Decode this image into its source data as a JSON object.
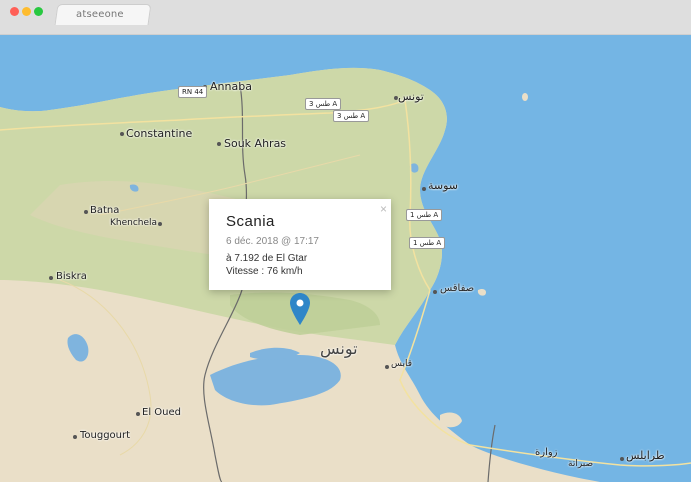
{
  "browser": {
    "tab_title": "atseeone"
  },
  "popup": {
    "title": "Scania",
    "date": "6 déc. 2018 @ 17:17",
    "location": "à 7.192 de El Gtar",
    "speed": "Vitesse : 76 km/h",
    "close": "×"
  },
  "map": {
    "cities": [
      "Annaba",
      "Constantine",
      "Souk Ahras",
      "Batna",
      "Khenchela",
      "Biskra",
      "El Oued",
      "Touggourt",
      "تونس",
      "سوسة",
      "صفاقس",
      "قابس",
      "زوارة",
      "صبراتة",
      "طرابلس",
      "تونس"
    ],
    "roads": [
      "RN 44",
      "طس 3 A",
      "طس 3 A",
      "طس 1 A",
      "طس 1 A"
    ],
    "colors": {
      "sea": "#74b5e4",
      "land": "#eadfc8",
      "green": "#c9d6a6",
      "lake": "#7fb4de",
      "border": "#6b6b6b"
    }
  }
}
